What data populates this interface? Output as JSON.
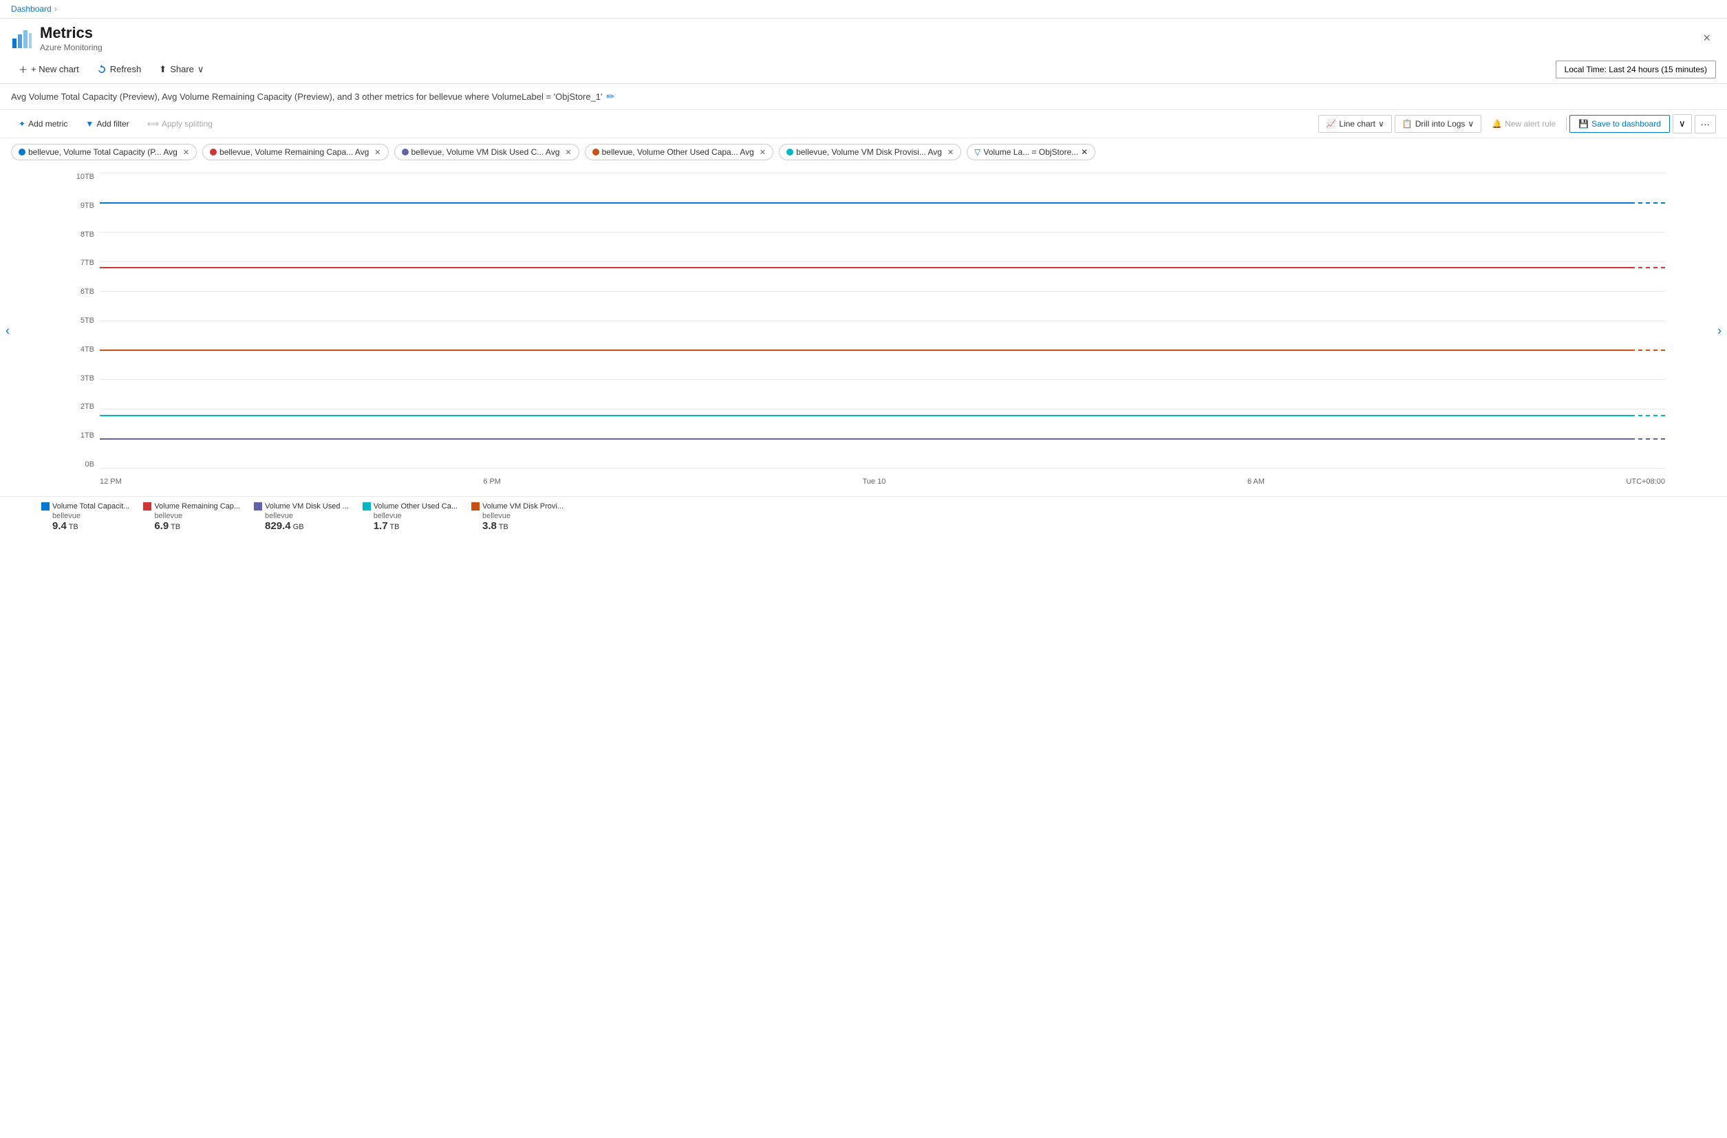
{
  "breadcrumb": {
    "label": "Dashboard",
    "sep": "›"
  },
  "header": {
    "title": "Metrics",
    "subtitle": "Azure Monitoring",
    "close_label": "×"
  },
  "toolbar": {
    "new_chart": "+ New chart",
    "refresh": "Refresh",
    "share": "Share",
    "time_range": "Local Time: Last 24 hours (15 minutes)"
  },
  "chart_title": "Avg Volume Total Capacity (Preview), Avg Volume Remaining Capacity (Preview), and 3 other metrics for bellevue where VolumeLabel = 'ObjStore_1'",
  "chart_tools": {
    "add_metric": "Add metric",
    "add_filter": "Add filter",
    "apply_splitting": "Apply splitting",
    "line_chart": "Line chart",
    "drill_into_logs": "Drill into Logs",
    "new_alert_rule": "New alert rule",
    "save_to_dashboard": "Save to dashboard"
  },
  "metrics": [
    {
      "id": 1,
      "color": "#0078d4",
      "label": "bellevue, Volume Total Capacity (P... Avg"
    },
    {
      "id": 2,
      "color": "#d13438",
      "label": "bellevue, Volume Remaining Capa... Avg"
    },
    {
      "id": 3,
      "color": "#6264a7",
      "label": "bellevue, Volume VM Disk Used C... Avg"
    },
    {
      "id": 4,
      "color": "#ca5010",
      "label": "bellevue, Volume Other Used Capa... Avg"
    },
    {
      "id": 5,
      "color": "#00b7c3",
      "label": "bellevue, Volume VM Disk Provisi... Avg"
    }
  ],
  "filter_tag": {
    "label": "Volume La... = ObjStore..."
  },
  "y_axis": [
    "10TB",
    "9TB",
    "8TB",
    "7TB",
    "6TB",
    "5TB",
    "4TB",
    "3TB",
    "2TB",
    "1TB",
    "0B"
  ],
  "x_axis": [
    "12 PM",
    "6 PM",
    "Tue 10",
    "6 AM",
    "UTC+08:00"
  ],
  "chart_lines": [
    {
      "color": "#0078d4",
      "pct": 87,
      "dashed_color": "#0078d4"
    },
    {
      "color": "#d13438",
      "pct": 68,
      "dashed_color": "#d13438"
    },
    {
      "color": "#ca5010",
      "pct": 38,
      "dashed_color": "#ca5010"
    },
    {
      "color": "#00b7c3",
      "pct": 16,
      "dashed_color": "#00b7c3"
    },
    {
      "color": "#6264a7",
      "pct": 8,
      "dashed_color": "#6264a7"
    }
  ],
  "legend": [
    {
      "color": "#0078d4",
      "name": "Volume Total Capacit...",
      "sub": "bellevue",
      "value": "9.4",
      "unit": "TB"
    },
    {
      "color": "#d13438",
      "name": "Volume Remaining Cap...",
      "sub": "bellevue",
      "value": "6.9",
      "unit": "TB"
    },
    {
      "color": "#6264a7",
      "name": "Volume VM Disk Used ...",
      "sub": "bellevue",
      "value": "829.4",
      "unit": "GB"
    },
    {
      "color": "#00b7c3",
      "name": "Volume Other Used Ca...",
      "sub": "bellevue",
      "value": "1.7",
      "unit": "TB"
    },
    {
      "color": "#ca5010",
      "name": "Volume VM Disk Provi...",
      "sub": "bellevue",
      "value": "3.8",
      "unit": "TB"
    }
  ]
}
